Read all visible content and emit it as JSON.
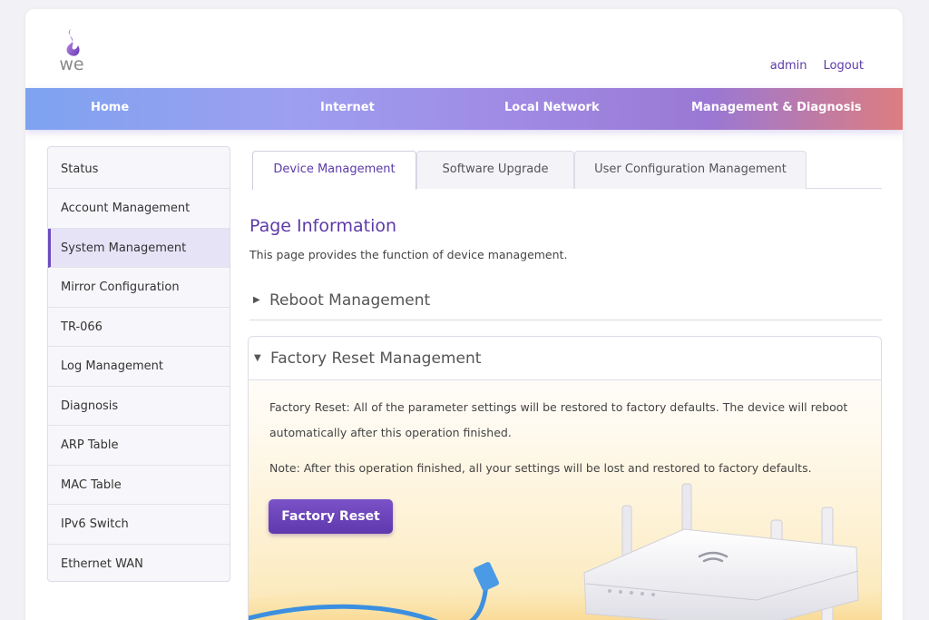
{
  "header": {
    "logo_text": "we",
    "links": {
      "admin": "admin",
      "logout": "Logout"
    }
  },
  "nav": {
    "items": [
      "Home",
      "Internet",
      "Local Network",
      "Management & Diagnosis"
    ]
  },
  "sidebar": {
    "items": [
      "Status",
      "Account Management",
      "System Management",
      "Mirror Configuration",
      "TR-066",
      "Log Management",
      "Diagnosis",
      "ARP Table",
      "MAC Table",
      "IPv6 Switch",
      "Ethernet WAN"
    ],
    "active": "System Management"
  },
  "tabs": {
    "items": [
      "Device Management",
      "Software Upgrade",
      "User Configuration Management"
    ],
    "active": "Device Management"
  },
  "main": {
    "title": "Page Information",
    "description": "This page provides the function of device management.",
    "reboot_section": "Reboot Management",
    "factory_section": "Factory Reset Management",
    "factory_text_1": "Factory Reset: All of the parameter settings will be restored to factory defaults. The device will reboot",
    "factory_text_2": "automatically after this operation finished.",
    "factory_note": "Note: After this operation finished, all your settings will be lost and restored to factory defaults.",
    "reset_button": "Factory Reset"
  },
  "colors": {
    "accent": "#5c3aa8",
    "nav_start": "#7ea3f0",
    "nav_end": "#dd7d80"
  },
  "icons": {
    "collapsed": "triangle-right-icon",
    "expanded": "triangle-down-icon"
  }
}
